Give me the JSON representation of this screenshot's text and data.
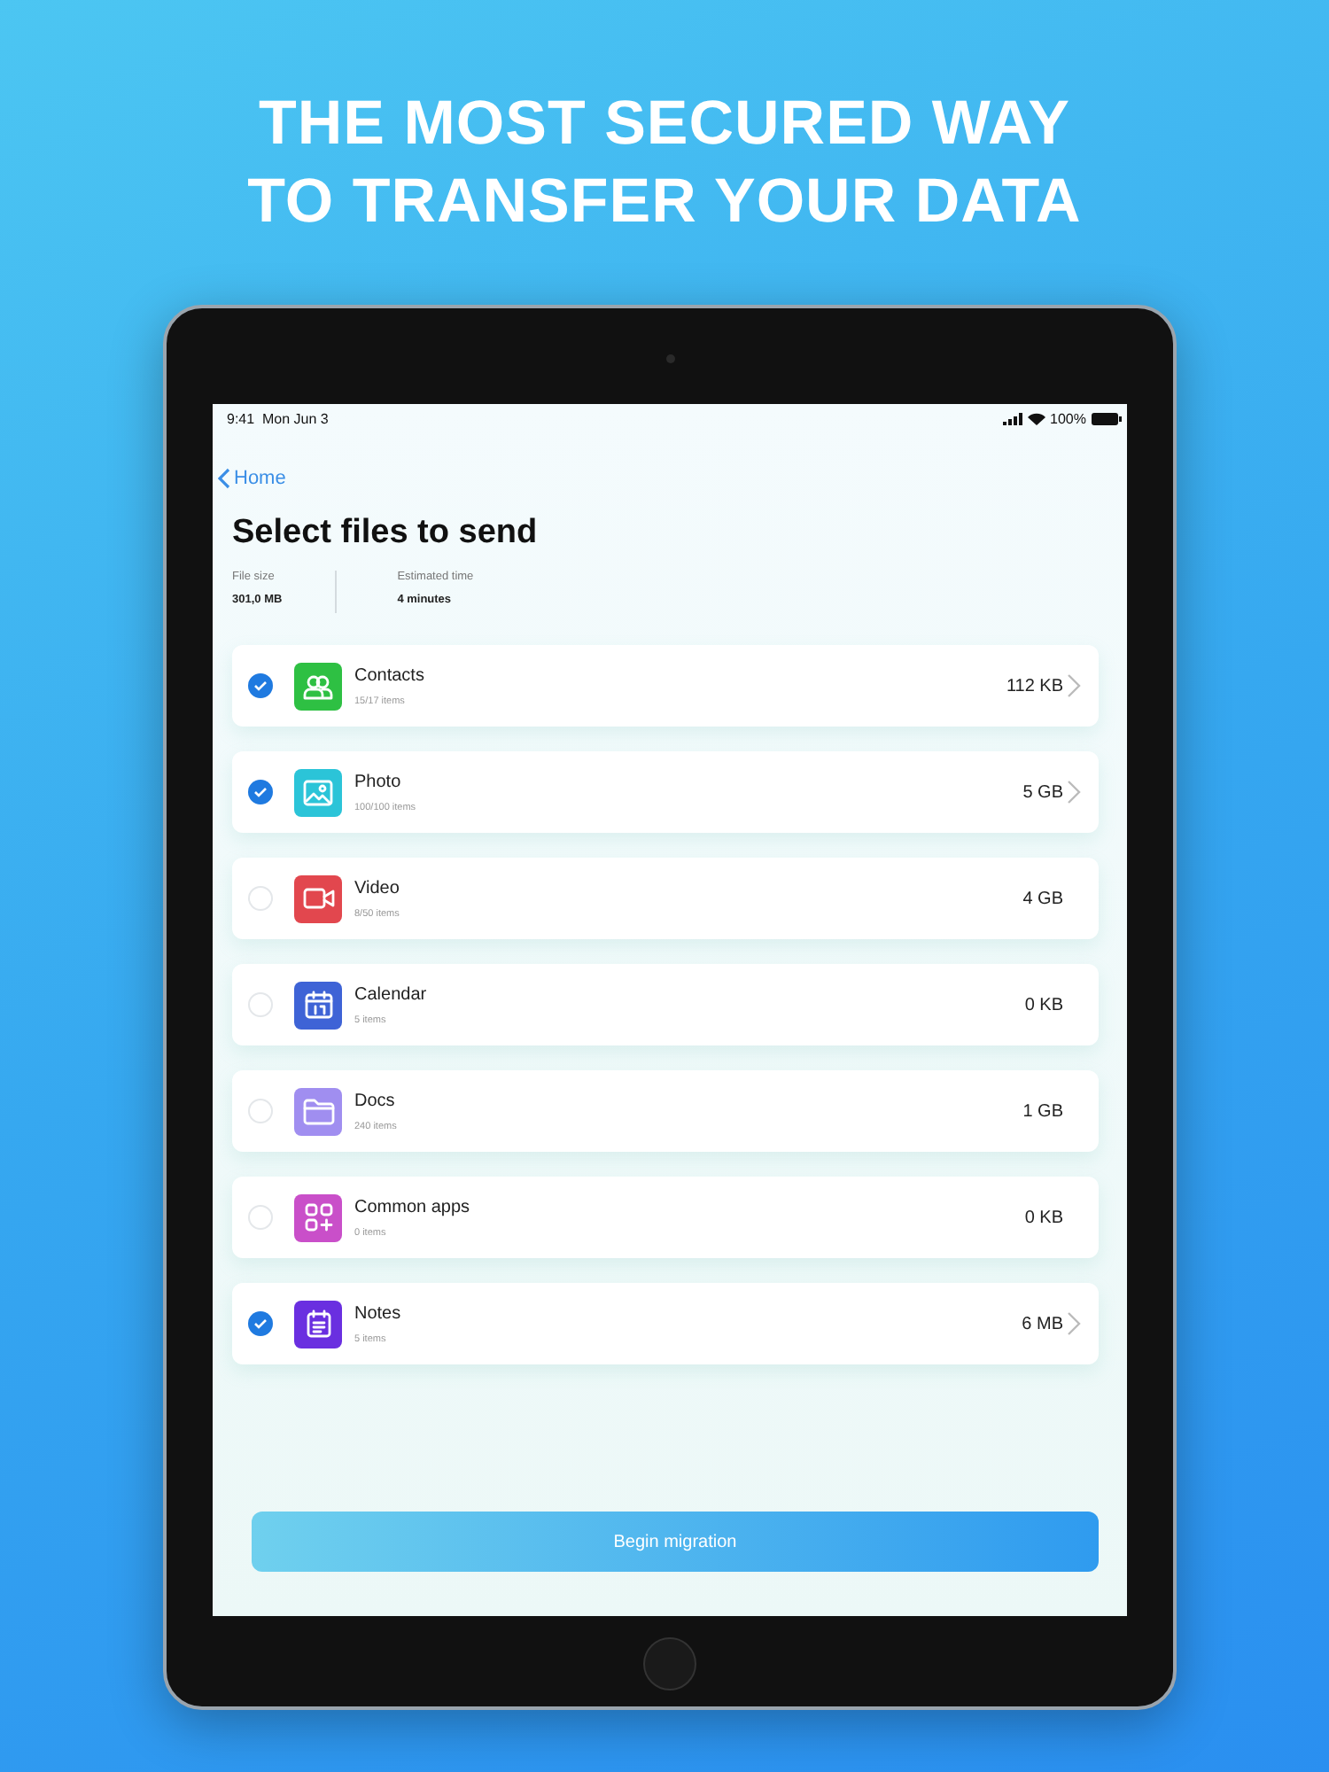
{
  "headline": [
    "THE MOST SECURED WAY",
    "TO TRANSFER YOUR DATA"
  ],
  "status_bar": {
    "time": "9:41  Mon Jun 3",
    "battery": "100%"
  },
  "back_link": "Home",
  "title": "Select files to send",
  "stats": [
    {
      "label": "File size",
      "value": "301,0 MB"
    },
    {
      "label": "Estimated time",
      "value": "4 minutes"
    }
  ],
  "files": [
    {
      "name": "Contacts",
      "count": "15/17 items",
      "size": "112 KB",
      "checked": true,
      "kind": "contacts",
      "color": "#2ec043"
    },
    {
      "name": "Photo",
      "count": "100/100 items",
      "size": "5 GB",
      "checked": true,
      "kind": "photo",
      "color": "#2bc4d8"
    },
    {
      "name": "Video",
      "count": "8/50 items",
      "size": "4 GB",
      "checked": false,
      "kind": "video",
      "color": "#e2474e"
    },
    {
      "name": "Calendar",
      "count": "5 items",
      "size": "0 KB",
      "checked": false,
      "kind": "calendar",
      "color": "#3e63d6"
    },
    {
      "name": "Docs",
      "count": "240 items",
      "size": "1 GB",
      "checked": false,
      "kind": "docs",
      "color": "#a08ef0"
    },
    {
      "name": "Common apps",
      "count": "0 items",
      "size": "0 KB",
      "checked": false,
      "kind": "apps",
      "color": "#c94fc9"
    },
    {
      "name": "Notes",
      "count": "5 items",
      "size": "6 MB",
      "checked": true,
      "kind": "notes",
      "color": "#6a2fe0"
    }
  ],
  "button": "Begin migration"
}
